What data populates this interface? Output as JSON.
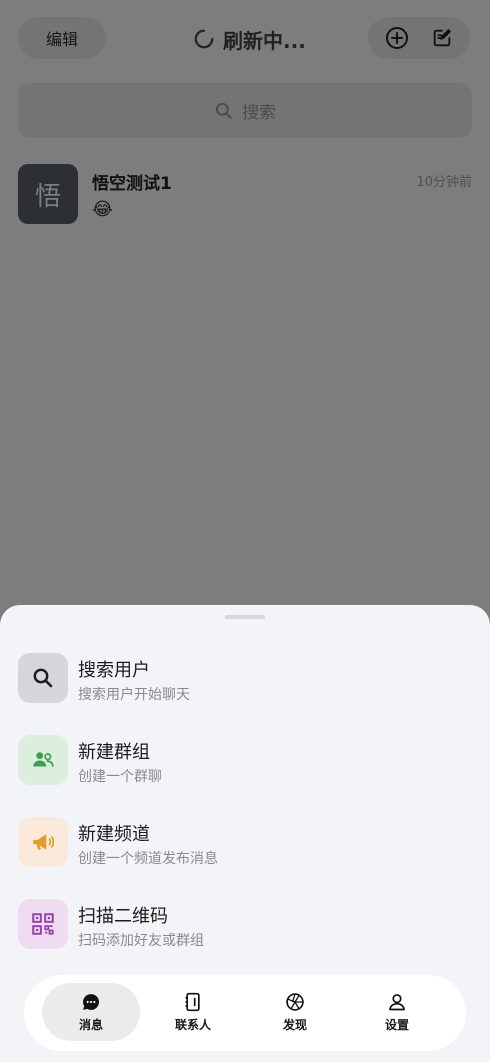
{
  "header": {
    "edit_label": "编辑",
    "title": "刷新中...",
    "spinner_icon": "loading-spinner-icon",
    "add_icon": "plus-circle-icon",
    "compose_icon": "compose-icon"
  },
  "search": {
    "placeholder": "搜索",
    "icon": "search-icon"
  },
  "conversations": [
    {
      "avatar_text": "悟",
      "name": "悟空测试1",
      "time": "10分钟前",
      "last_message": "😂"
    }
  ],
  "sheet": {
    "items": [
      {
        "title": "搜索用户",
        "subtitle": "搜索用户开始聊天",
        "icon": "search-icon",
        "icon_bg": "#d6d6da",
        "icon_color": "#1a1a1a"
      },
      {
        "title": "新建群组",
        "subtitle": "创建一个群聊",
        "icon": "group-icon",
        "icon_bg": "#dcefdf",
        "icon_color": "#3f9e54"
      },
      {
        "title": "新建频道",
        "subtitle": "创建一个频道发布消息",
        "icon": "megaphone-icon",
        "icon_bg": "#fbeadb",
        "icon_color": "#e39a2a"
      },
      {
        "title": "扫描二维码",
        "subtitle": "扫码添加好友或群组",
        "icon": "qr-code-icon",
        "icon_bg": "#efdcf1",
        "icon_color": "#9a3dae"
      }
    ]
  },
  "bottom_nav": {
    "items": [
      {
        "label": "消息",
        "icon": "chat-icon",
        "active": true
      },
      {
        "label": "联系人",
        "icon": "contacts-icon",
        "active": false
      },
      {
        "label": "发现",
        "icon": "aperture-icon",
        "active": false
      },
      {
        "label": "设置",
        "icon": "user-settings-icon",
        "active": false
      }
    ]
  }
}
